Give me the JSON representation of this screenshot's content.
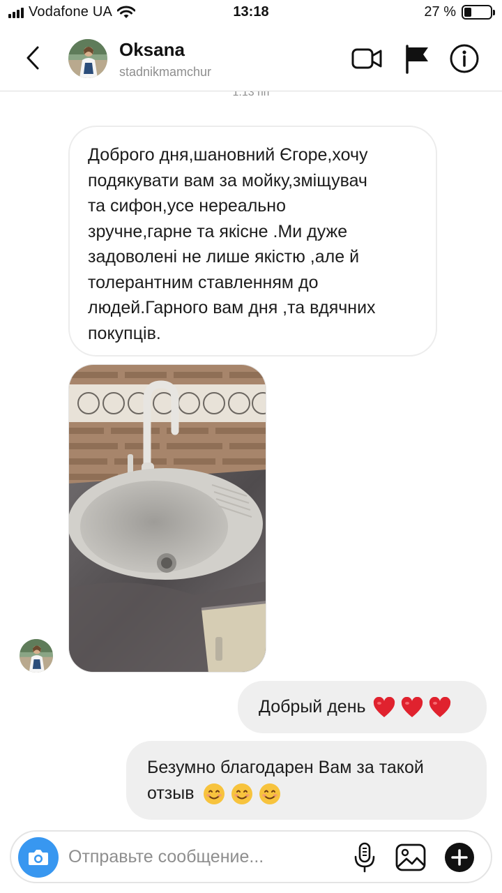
{
  "status_bar": {
    "carrier": "Vodafone UA",
    "time": "13:18",
    "battery_percent": "27 %",
    "battery_level": 0.27
  },
  "header": {
    "name": "Oksana",
    "username": "stadnikmamchur",
    "icons": [
      "back-icon",
      "video-call-icon",
      "flag-icon",
      "info-icon"
    ]
  },
  "timestamp": "1:13 пп",
  "messages": {
    "incoming_text": "Доброго дня,шановний Єгоре,хочу\nподякувати вам за мойку,зміщувач\nта сифон,усе нереально\nзручне,гарне та якісне .Ми дуже\nзадоволені не лише якістю ,але й\nтолерантним ставленням до\nлюдей.Гарного вам дня ,та вдячних\nпокупців.",
    "reply_1_text": "Добрый день",
    "reply_2_text": "Безумно благодарен Вам за такой",
    "reply_2_text_line2": "отзыв",
    "heart_color": "#e0222e",
    "emoji_color": "#f7c33d"
  },
  "composer": {
    "placeholder": "Отправьте сообщение...",
    "accent_color": "#3897f0"
  }
}
